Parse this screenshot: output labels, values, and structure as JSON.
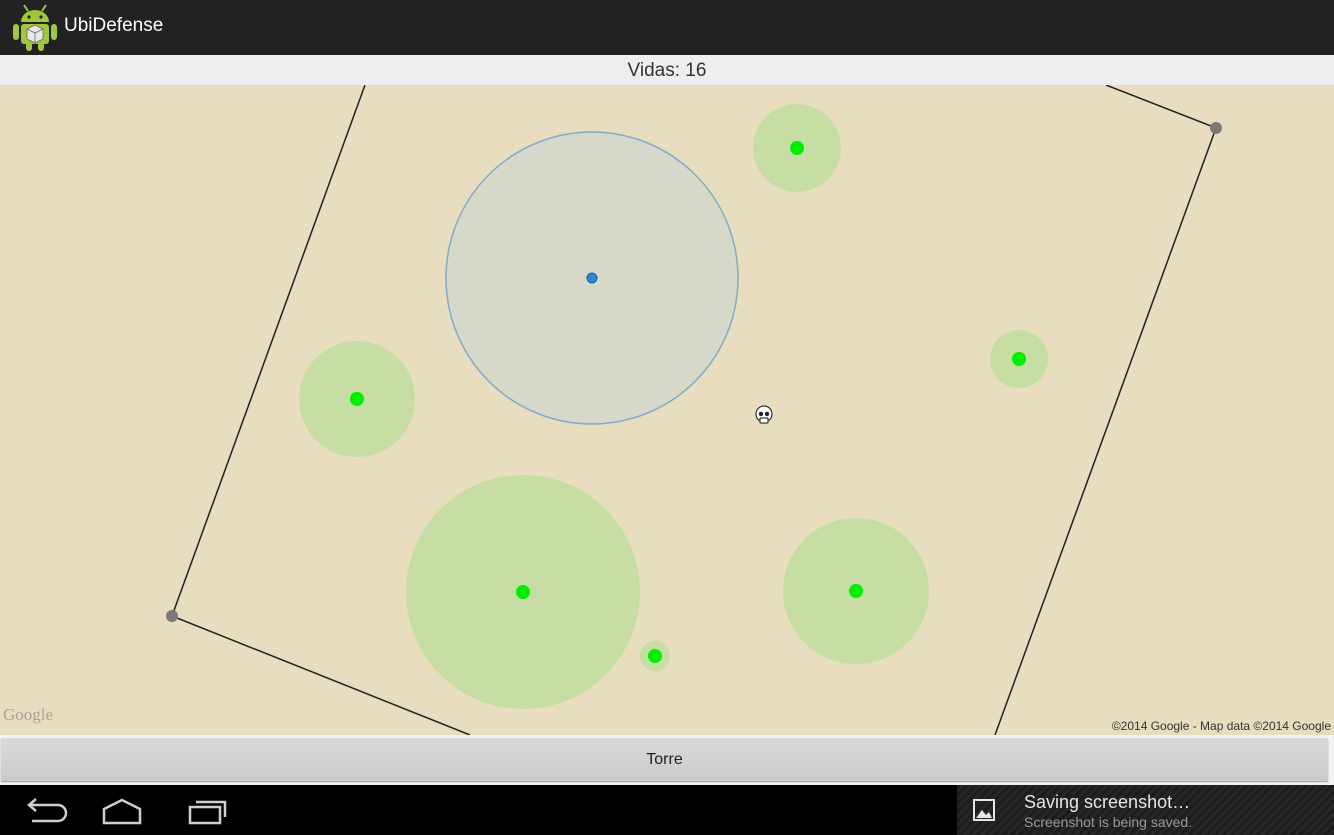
{
  "app": {
    "title": "UbiDefense",
    "icon": "android-app-icon"
  },
  "status": {
    "lives_text": "Vidas: 16"
  },
  "map": {
    "google_logo": "Google",
    "attribution": "©2014 Google - Map data ©2014 Google",
    "path_corner_icon": "gray-circle-marker",
    "player_icon": "blue-location-dot",
    "enemy_icon": "skull-icon",
    "tower_icon": "green-dot",
    "colors": {
      "background": "#e8ddbe",
      "tower_range": "#c6dda3",
      "tower": "#00ee00",
      "player_range": "#d6d9c9",
      "path": "#222222"
    }
  },
  "controls": {
    "tower_button_label": "Torre"
  },
  "navbar": {
    "back_icon": "back-icon",
    "home_icon": "home-icon",
    "recents_icon": "recents-icon"
  },
  "notification": {
    "title": "Saving screenshot…",
    "subtitle": "Screenshot is being saved.",
    "icon": "image-icon"
  }
}
